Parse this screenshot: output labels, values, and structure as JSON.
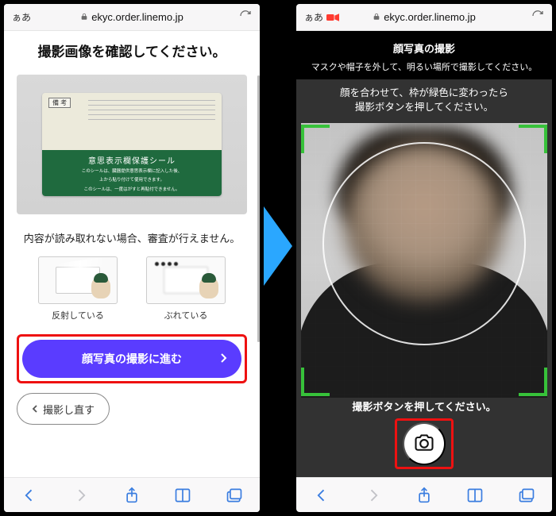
{
  "left": {
    "addr": {
      "aa": "ぁあ",
      "url": "ekyc.order.linemo.jp"
    },
    "title": "撮影画像を確認してください。",
    "card": {
      "top_label": "備 考",
      "green_title": "意思表示欄保護シール",
      "green_line1": "このシールは、臓器提供意思表示欄に記入した後、",
      "green_line2": "上から貼り付けて使用できます。",
      "green_line3": "このシールは、一度はがすと再貼付できません。"
    },
    "subtitle": "内容が読み取れない場合、審査が行えません。",
    "examples": {
      "reflect": "反射している",
      "blurry": "ぶれている"
    },
    "primary_button": "顔写真の撮影に進む",
    "retake_button": "撮影し直す"
  },
  "right": {
    "addr": {
      "aa": "ぁあ",
      "url": "ekyc.order.linemo.jp"
    },
    "title": "顔写真の撮影",
    "sub1": "マスクや帽子を外して、明るい場所で撮影してください。",
    "sub2a": "顔を合わせて、枠が緑色に変わったら",
    "sub2b": "撮影ボタンを押してください。",
    "press": "撮影ボタンを押してください。"
  }
}
